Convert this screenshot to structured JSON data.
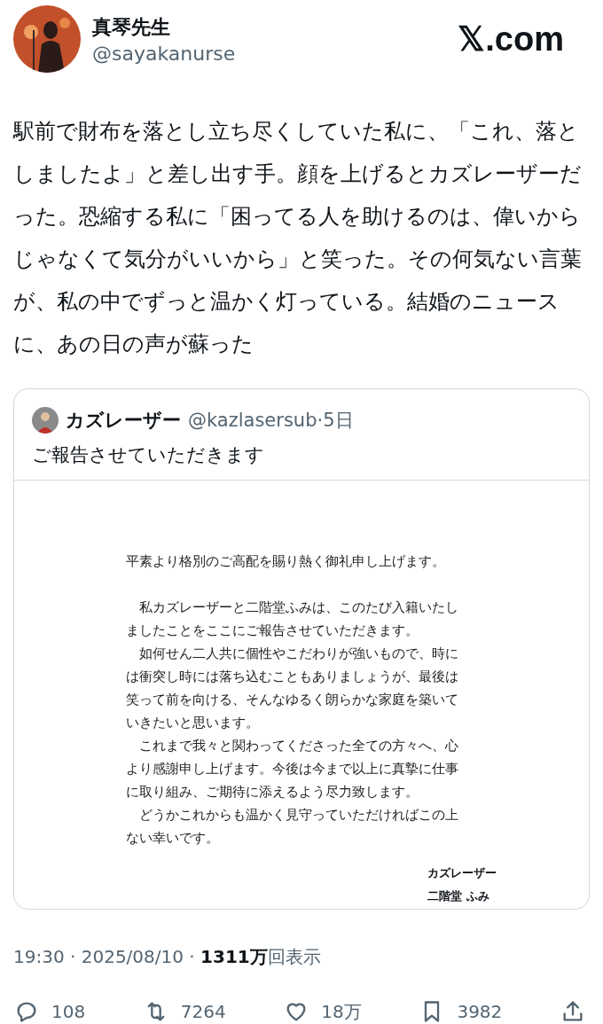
{
  "author": {
    "name": "真琴先生",
    "handle": "@sayakanurse"
  },
  "site_logo": {
    "mark": "𝕏",
    "text": ".com"
  },
  "tweet_text": "駅前で財布を落とし立ち尽くしていた私に、「これ、落としましたよ」と差し出す手。顔を上げるとカズレーザーだった。恐縮する私に「困ってる人を助けるのは、偉いからじゃなくて気分がいいから」と笑った。その何気ない言葉が、私の中でずっと温かく灯っている。結婚のニュースに、あの日の声が蘇った",
  "quoted": {
    "name": "カズレーザー",
    "handle": "@kazlasersub",
    "time": "·5日",
    "text": "ご報告させていただきます",
    "letter": {
      "lines": [
        {
          "kind": "line",
          "text": "平素より格別のご高配を賜り熱く御礼申し上げます。"
        },
        {
          "kind": "gap"
        },
        {
          "kind": "line",
          "text": "　私カズレーザーと二階堂ふみは、このたび入籍いたし"
        },
        {
          "kind": "line",
          "text": "ましたことをここにご報告させていただきます。"
        },
        {
          "kind": "line",
          "text": "　如何せん二人共に個性やこだわりが強いもので、時に"
        },
        {
          "kind": "line",
          "text": "は衝突し時には落ち込むこともありましょうが、最後は"
        },
        {
          "kind": "line",
          "text": "笑って前を向ける、そんなゆるく朗らかな家庭を築いて"
        },
        {
          "kind": "line",
          "text": "いきたいと思います。"
        },
        {
          "kind": "line",
          "text": "　これまで我々と関わってくださった全ての方々へ、心"
        },
        {
          "kind": "line",
          "text": "より感謝申し上げます。今後は今まで以上に真摯に仕事"
        },
        {
          "kind": "line",
          "text": "に取り組み、ご期待に添えるよう尽力致します。"
        },
        {
          "kind": "line",
          "text": "　どうかこれからも温かく見守っていただければこの上"
        },
        {
          "kind": "line",
          "text": "ない幸いです。"
        }
      ],
      "signatures": [
        "カズレーザー",
        "二階堂 ふみ"
      ]
    }
  },
  "meta": {
    "time": "19:30 · 2025/08/10 · ",
    "views": "1311万",
    "views_label": "回表示"
  },
  "actions": [
    {
      "kind": "reply",
      "count": "108"
    },
    {
      "kind": "repost",
      "count": "7264"
    },
    {
      "kind": "like",
      "count": "18万"
    },
    {
      "kind": "bookmark",
      "count": "3982"
    },
    {
      "kind": "share"
    }
  ]
}
